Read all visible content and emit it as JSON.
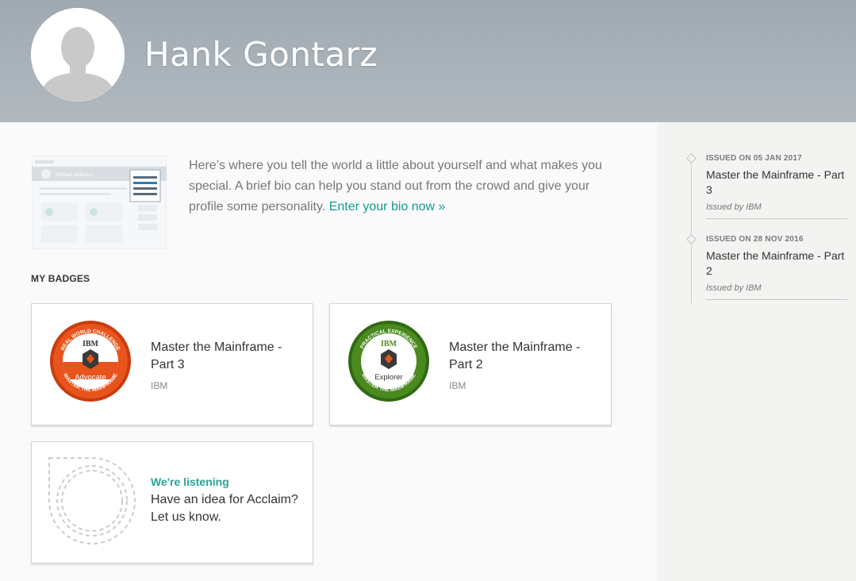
{
  "profile": {
    "name": "Hank Gontarz"
  },
  "bio": {
    "prompt": "Here’s where you tell the world a little about yourself and what makes you special. A brief bio can help you stand out from the crowd and give your profile some personality.",
    "link": "Enter your bio now »",
    "preview_label": "Michael Jefferson"
  },
  "badges_section": {
    "title": "MY BADGES",
    "items": [
      {
        "name": "Master the Mainframe - Part 3",
        "issuer": "IBM",
        "ring_top": "REAL WORLD CHALLENGE",
        "ring_bottom": "MASTER THE MAINFRAME",
        "level": "Advocate",
        "logo": "IBM",
        "color": "#e04e18"
      },
      {
        "name": "Master the Mainframe - Part 2",
        "issuer": "IBM",
        "ring_top": "PRACTICAL EXPERIENCE",
        "ring_bottom": "MASTER THE MAINFRAME",
        "level": "Explorer",
        "logo": "IBM",
        "color": "#4a8a1f"
      }
    ]
  },
  "feedback": {
    "heading": "We're listening",
    "text": "Have an idea for Acclaim? Let us know."
  },
  "timeline": [
    {
      "date": "ISSUED ON 05 JAN 2017",
      "title": "Master the Mainframe - Part 3",
      "issuer": "Issued by IBM"
    },
    {
      "date": "ISSUED ON 28 NOV 2016",
      "title": "Master the Mainframe - Part 2",
      "issuer": "Issued by IBM"
    }
  ],
  "colors": {
    "accent": "#159a8c",
    "header": "#a6afb6",
    "sidebar": "#f3f3f1"
  }
}
